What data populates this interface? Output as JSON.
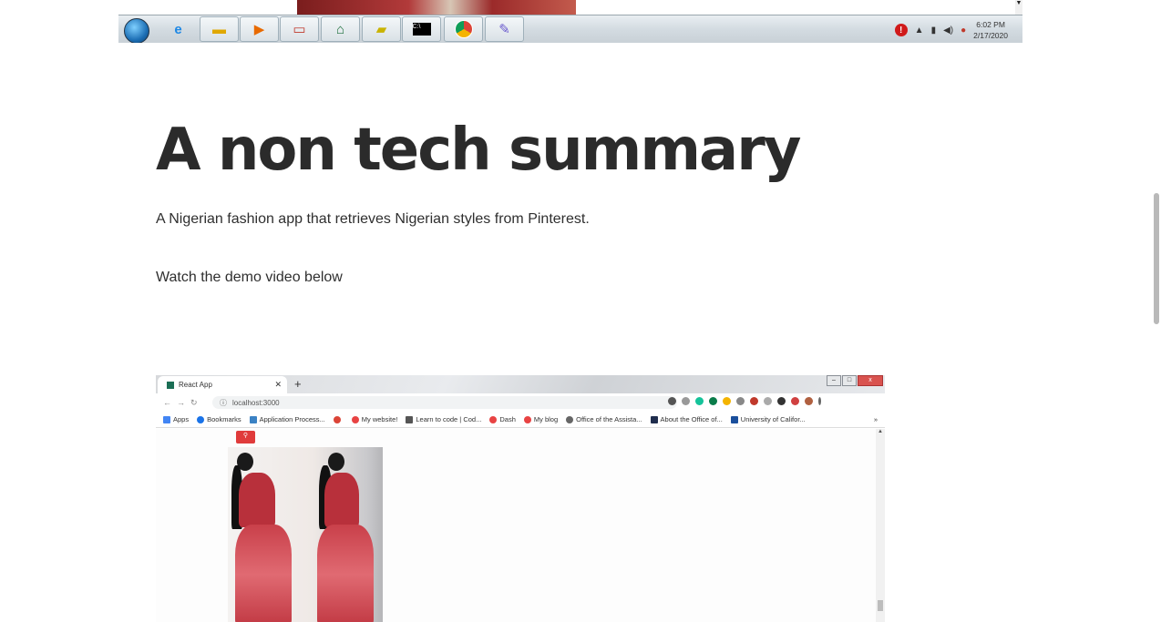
{
  "taskbar": {
    "apps": [
      "start-orb",
      "internet-explorer-icon",
      "file-explorer-icon",
      "media-player-icon",
      "laptop-icon",
      "hp-icon",
      "sticky-notes-icon",
      "terminal-icon",
      "chrome-icon",
      "paint-icon"
    ],
    "time": "6:02 PM",
    "date": "2/17/2020"
  },
  "article": {
    "heading": "A non tech summary",
    "description": "A Nigerian fashion app that retrieves Nigerian styles from Pinterest.",
    "demo_prompt": "Watch the demo video below"
  },
  "demo": {
    "tab_title": "React App",
    "url": "localhost:3000",
    "bookmarks": [
      {
        "label": "Apps",
        "color": "#4285f4"
      },
      {
        "label": "Bookmarks",
        "color": "#1a73e8"
      },
      {
        "label": "Application Process...",
        "color": "#3b82c4"
      },
      {
        "label": "",
        "color": "#db4437"
      },
      {
        "label": "My website!",
        "color": "#e84343"
      },
      {
        "label": "Learn to code | Cod...",
        "color": "#555555"
      },
      {
        "label": "Dash",
        "color": "#e84343"
      },
      {
        "label": "My blog",
        "color": "#e84343"
      },
      {
        "label": "Office of the Assista...",
        "color": "#666666"
      },
      {
        "label": "About the Office of...",
        "color": "#1f2d4d"
      },
      {
        "label": "University of Califor...",
        "color": "#1a4f9c"
      }
    ],
    "more": "»"
  }
}
